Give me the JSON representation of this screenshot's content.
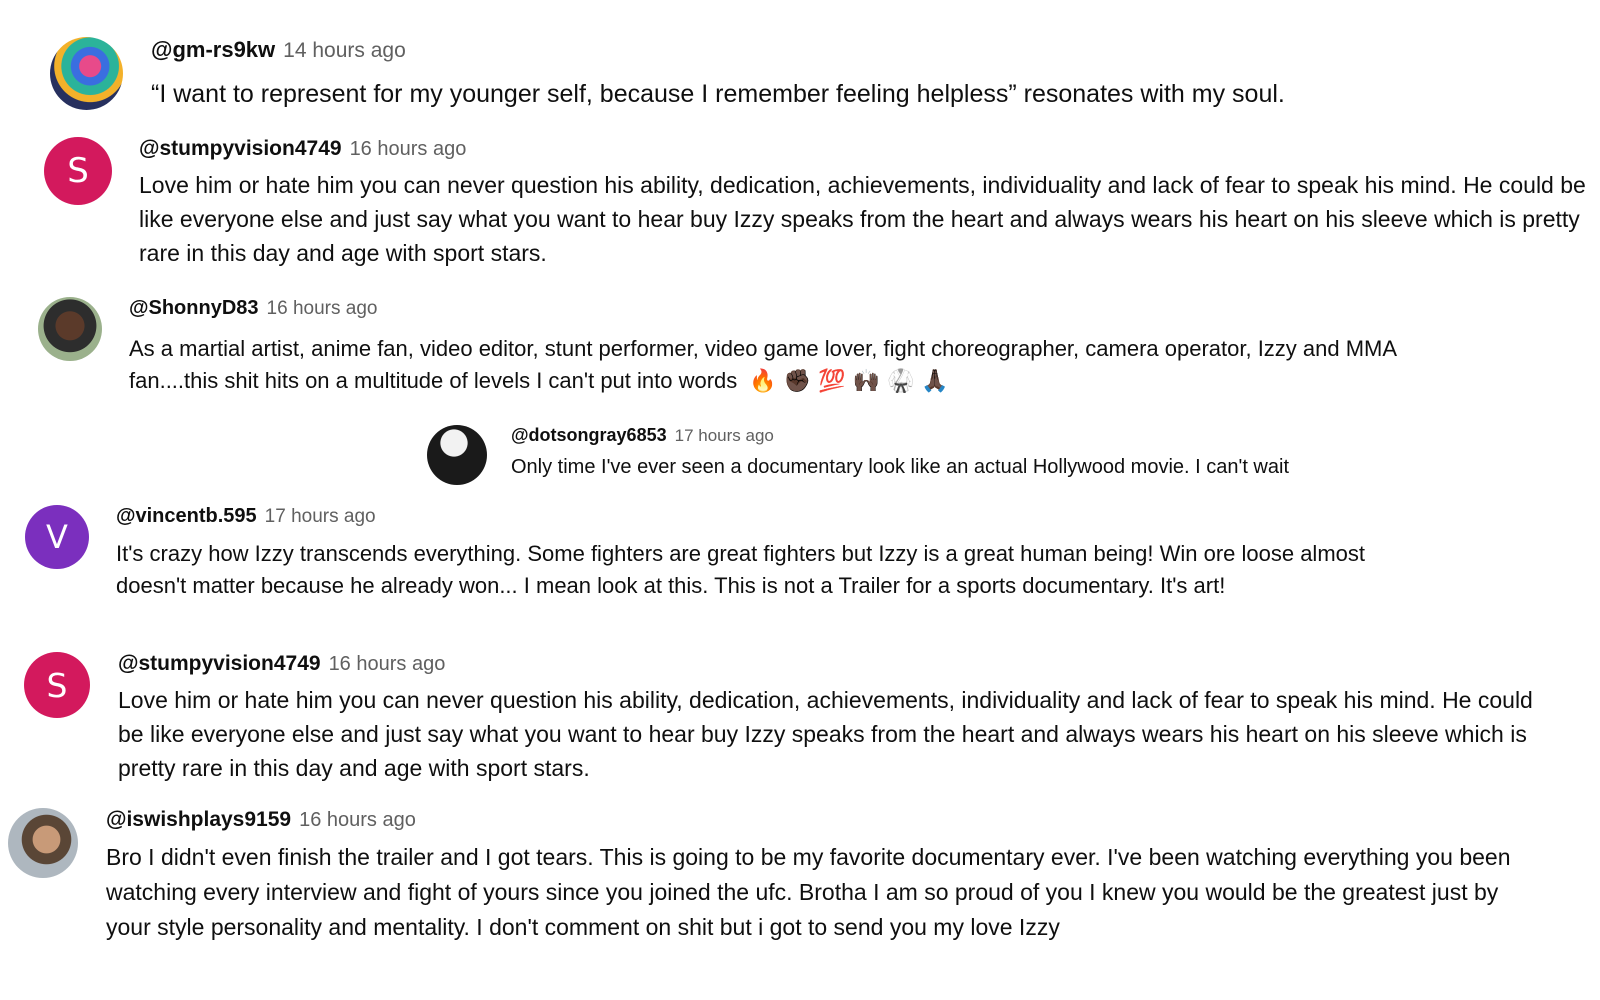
{
  "comments": [
    {
      "handle": "@gm-rs9kw",
      "time": "14 hours ago",
      "text": "“I want to represent for my younger self, because I remember feeling helpless” resonates with my soul.",
      "avatar": {
        "type": "image",
        "icon": "psychedelic-art-avatar"
      }
    },
    {
      "handle": "@stumpyvision4749",
      "time": "16 hours ago",
      "text": "Love him or hate him you can never question his ability, dedication, achievements, individuality and lack of fear to speak his mind. He could be like everyone else and just say what you want to hear buy Izzy speaks from the heart and always wears his heart on his sleeve which is pretty rare in this day and age with sport stars.",
      "avatar": {
        "type": "letter",
        "letter": "S",
        "color": "#d3195d"
      }
    },
    {
      "handle": "@ShonnyD83",
      "time": "16 hours ago",
      "text": "As a martial artist, anime fan, video editor, stunt performer, video game lover, fight choreographer, camera operator, Izzy and MMA fan....this shit hits on a multitude of levels I can't put into words",
      "emojis": "🔥 ✊🏿 💯 🙌🏿 🥋 🙏🏿",
      "avatar": {
        "type": "image",
        "icon": "person-photo-avatar"
      }
    },
    {
      "handle": "@dotsongray6853",
      "time": "17 hours ago",
      "text": "Only time I've ever seen a documentary look like an actual Hollywood movie. I can't wait",
      "avatar": {
        "type": "image",
        "icon": "person-cap-avatar"
      }
    },
    {
      "handle": "@vincentb.595",
      "time": "17 hours ago",
      "text": "It's crazy how Izzy transcends everything. Some fighters are great fighters but Izzy is a great human being! Win ore loose almost doesn't matter because he already won... I mean look at this. This is not a Trailer for a sports documentary. It's art!",
      "avatar": {
        "type": "letter",
        "letter": "V",
        "color": "#7b2fbe"
      }
    },
    {
      "handle": "@stumpyvision4749",
      "time": "16 hours ago",
      "text": "Love him or hate him you can never question his ability, dedication, achievements, individuality and lack of fear to speak his mind. He could be like everyone else and just say what you want to hear buy Izzy speaks from the heart and always wears his heart on his sleeve which is pretty rare in this day and age with sport stars.",
      "avatar": {
        "type": "letter",
        "letter": "S",
        "color": "#d3195d"
      }
    },
    {
      "handle": "@iswishplays9159",
      "time": "16 hours ago",
      "text": "Bro I didn't even finish the trailer and I got tears. This is going to be my favorite documentary ever. I've been watching everything you been watching every interview and fight of yours since you joined the ufc. Brotha I am so proud of you I knew you would be the greatest just by your style personality and mentality. I don't comment on shit but i got to send you my love  Izzy",
      "avatar": {
        "type": "image",
        "icon": "person-glasses-avatar"
      }
    }
  ]
}
